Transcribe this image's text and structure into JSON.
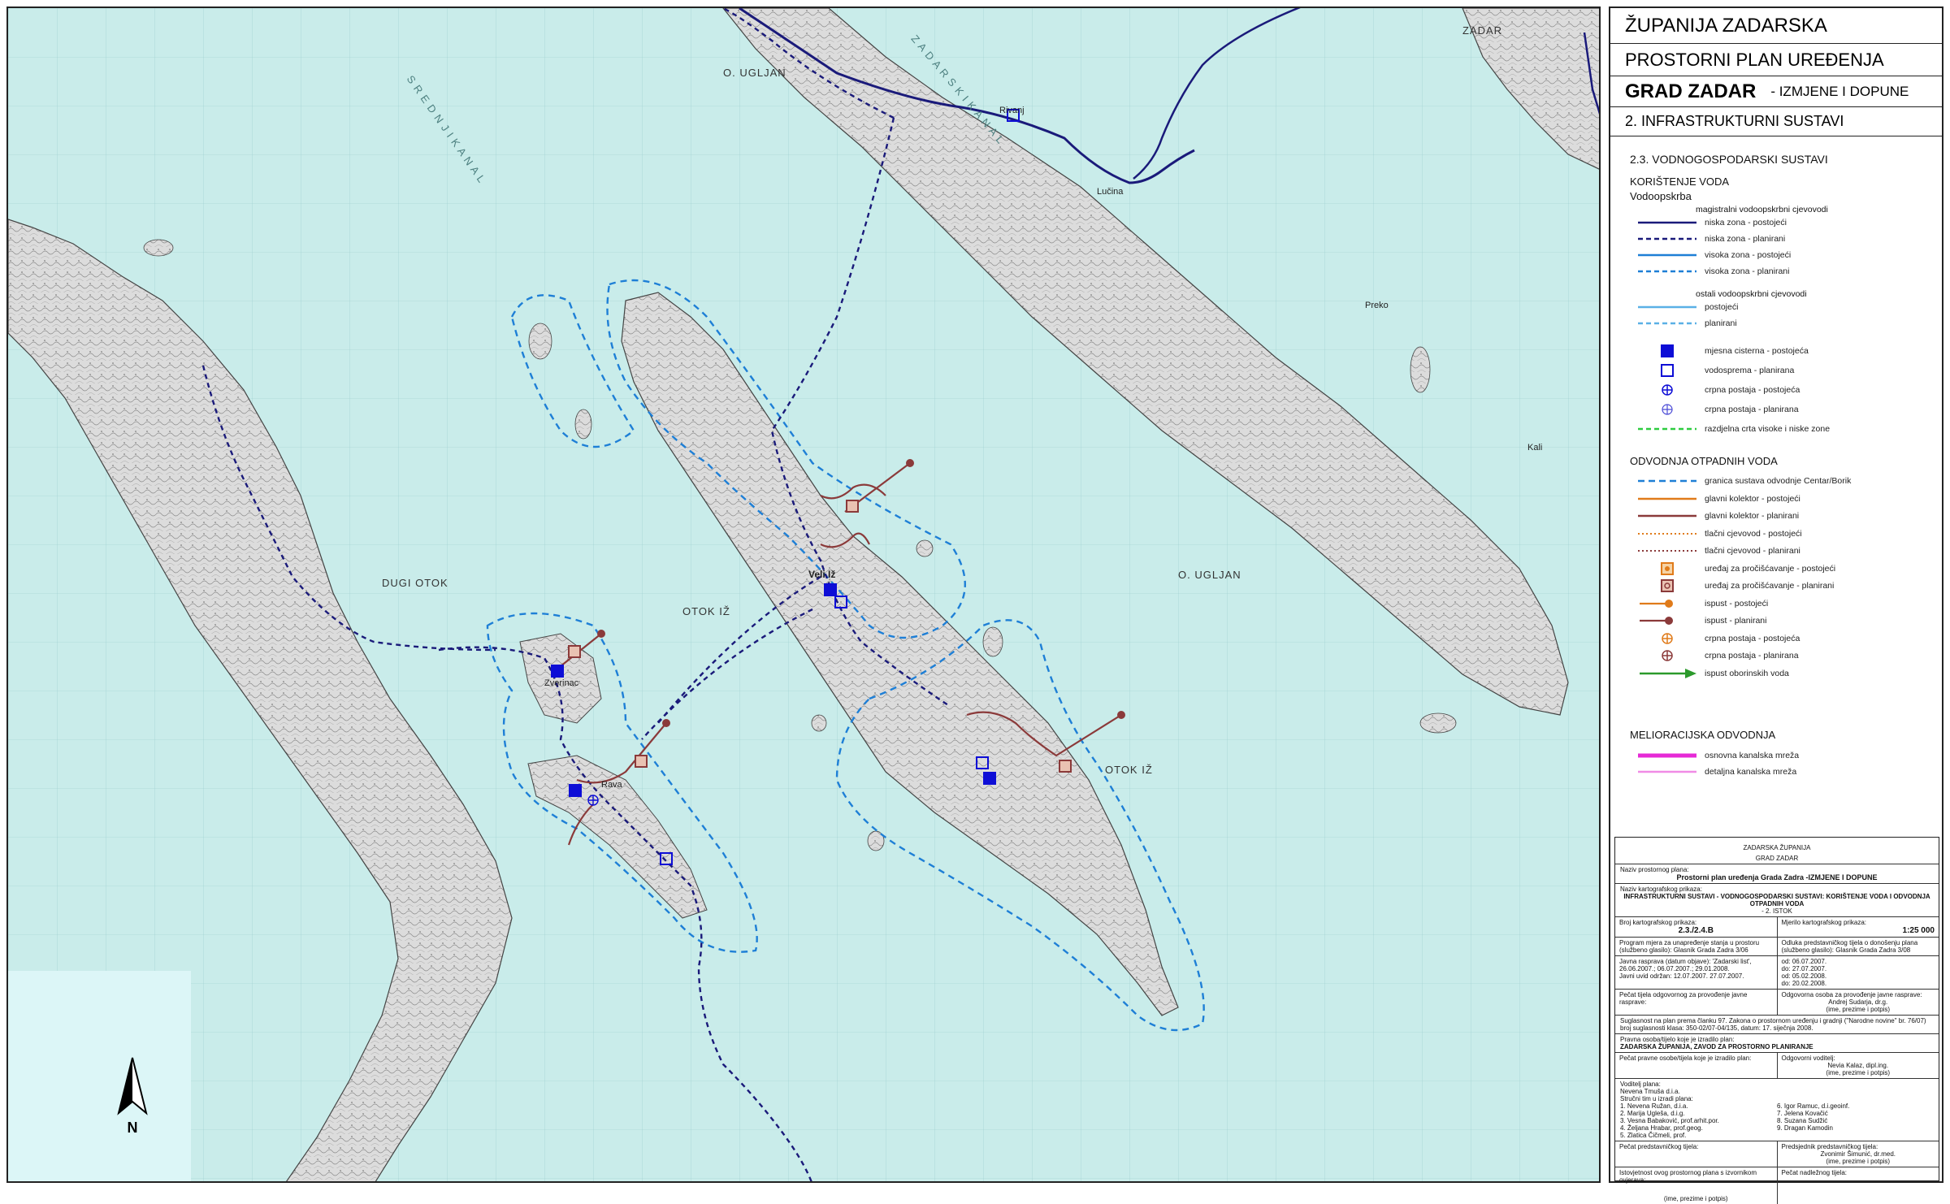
{
  "header": {
    "county": "ŽUPANIJA ZADARSKA",
    "plan": "PROSTORNI PLAN UREĐENJA",
    "city": "GRAD ZADAR",
    "city_suffix": "- IZMJENE I DOPUNE",
    "section": "2. INFRASTRUKTURNI SUSTAVI"
  },
  "legend": {
    "heading": "2.3. VODNOGOSPODARSKI SUSTAVI",
    "water_use": "KORIŠTENJE VODA",
    "supply": "Vodoopskrba",
    "main_pipe_title": "magistralni vodoopskrbni cjevovodi",
    "supply_items": [
      {
        "label": "niska zona - postojeći",
        "color": "#1a1a7a",
        "style": "solid"
      },
      {
        "label": "niska zona - planirani",
        "color": "#1a1a7a",
        "style": "dashed"
      },
      {
        "label": "visoka zona - postojeći",
        "color": "#1e7fd6",
        "style": "solid"
      },
      {
        "label": "visoka zona - planirani",
        "color": "#1e7fd6",
        "style": "dashed"
      }
    ],
    "other_pipe_title": "ostali vodoopskrbni cjevovodi",
    "other_items": [
      {
        "label": "postojeći",
        "color": "#5ab0e6",
        "style": "solid"
      },
      {
        "label": "planirani",
        "color": "#5ab0e6",
        "style": "dashed"
      }
    ],
    "symbol_items": [
      {
        "label": "mjesna cisterna - postojeća",
        "symbol": "square-filled"
      },
      {
        "label": "vodosprema - planirana",
        "symbol": "square-open"
      },
      {
        "label": "crpna postaja - postojeća",
        "symbol": "pump-existing"
      },
      {
        "label": "crpna postaja - planirana",
        "symbol": "pump-planned"
      },
      {
        "label": "razdjelna crta visoke i niske zone",
        "symbol": "green-dashed"
      }
    ],
    "waste_heading": "ODVODNJA OTPADNIH VODA",
    "waste_items": [
      {
        "label": "granica sustava odvodnje Centar/Borik",
        "symbol": "blue-dashed"
      },
      {
        "label": "glavni kolektor - postojeći",
        "symbol": "orange-solid"
      },
      {
        "label": "glavni kolektor - planirani",
        "symbol": "brown-solid"
      },
      {
        "label": "tlačni cjevovod - postojeći",
        "symbol": "orange-dotted"
      },
      {
        "label": "tlačni cjevovod - planirani",
        "symbol": "brown-dotted"
      },
      {
        "label": "uređaj za pročišćavanje - postojeći",
        "symbol": "plant-existing"
      },
      {
        "label": "uređaj za pročišćavanje - planirani",
        "symbol": "plant-planned"
      },
      {
        "label": "ispust - postojeći",
        "symbol": "outlet-existing"
      },
      {
        "label": "ispust - planirani",
        "symbol": "outlet-planned"
      },
      {
        "label": "crpna postaja - postojeća",
        "symbol": "pump-orange"
      },
      {
        "label": "crpna postaja - planirana",
        "symbol": "pump-brown"
      },
      {
        "label": "ispust oborinskih voda",
        "symbol": "green-arrow"
      }
    ],
    "melio_heading": "MELIORACIJSKA ODVODNJA",
    "melio_items": [
      {
        "label": "osnovna kanalska mreža",
        "symbol": "magenta-thick"
      },
      {
        "label": "detaljna kanalska mreža",
        "symbol": "pink-thin"
      }
    ]
  },
  "title_block": {
    "top1": "ZADARSKA ŽUPANIJA",
    "top2": "GRAD ZADAR",
    "plan_label": "Naziv prostornog plana:",
    "plan_name": "Prostorni plan uređenja Grada Zadra -IZMJENE I DOPUNE",
    "map_label": "Naziv kartografskog prikaza:",
    "map_name": "INFRASTRUKTURNI SUSTAVI - VODNOGOSPODARSKI SUSTAVI: KORIŠTENJE VODA I ODVODNJA OTPADNIH VODA",
    "map_sub": "- 2. ISTOK",
    "num_label": "Broj kartografskog prikaza:",
    "num": "2.3./2.4.B",
    "scale_label": "Mjerilo kartografskog prikaza:",
    "scale": "1:25 000",
    "program": "Program mjera za unapređenje stanja u prostoru (službeno glasilo): Glasnik Grada Zadra 3/06",
    "decision": "Odluka predstavničkog tijela o donošenju plana (službeno glasilo): Glasnik Grada Zadra 3/08",
    "debate": "Javna rasprava (datum objave): 'Zadarski list', 26.06.2007.; 06.07.2007.; 29.01.2008.",
    "insight": "Javni uvid održan: 12.07.2007. 27.07.2007.",
    "insight_from": "od: 06.07.2007.",
    "insight_to": "do: 27.07.2007.",
    "repeat_from": "od: 05.02.2008.",
    "repeat_to": "do: 20.02.2008.",
    "seal1": "Pečat tijela odgovornog za provođenje javne rasprave:",
    "resp": "Odgovorna osoba za provođenje javne rasprave:",
    "resp_name": "Andrej Sudarja, dr.g.",
    "sign": "(ime, prezime i potpis)",
    "consent": "Suglasnost na plan prema članku 97. Zakona o prostornom uređenju i gradnji (\"Narodne novine\" br. 76/07) broj suglasnosti klasa: 350-02/07-04/135, datum: 17. siječnja 2008.",
    "maker_label": "Pravna osoba/tijelo koje je izradilo plan:",
    "maker": "ZADARSKA ŽUPANIJA, ZAVOD ZA PROSTORNO PLANIRANJE",
    "seal2": "Pečat pravne osobe/tijela koje je izradilo plan:",
    "manager": "Odgovorni voditelj:",
    "manager_name": "Nevia Kalaz, dipl.ing.",
    "lead_label": "Voditelj plana:",
    "lead": "Nevena Tmuša d.i.a.",
    "team_label": "Stručni tim u izradi plana:",
    "team_left": [
      "1. Nevena Ružan, d.i.a.",
      "2. Marija Ugleša, d.i.g.",
      "3. Vesna Babaković, prof.arhit.por.",
      "4. Željana Hrabar, prof.geog.",
      "5. Zlatica Čičmeli, prof."
    ],
    "team_right": [
      "6. Igor Ramuc, d.i.geoinf.",
      "7. Jelena Kovačić",
      "8. Suzana Sudžić",
      "9. Dragan Kamodin"
    ],
    "seal3": "Pečat predstavničkog tijela:",
    "chairman": "Predsjednik predstavničkog tijela:",
    "chairman_name": "Zvonimir Šimunić, dr.med.",
    "certify": "Istovjetnost ovog prostornog plana s izvornikom ovjerava:",
    "seal4": "Pečat nadležnog tijela:"
  },
  "map": {
    "north": "N",
    "places": [
      "O. UGLJAN",
      "ZADAR",
      "DUGI OTOK",
      "OTOK IŽ",
      "O. UGLJAN",
      "OTOK IŽ",
      "Veli Iž",
      "Preko",
      "Kali",
      "Rava",
      "Lučina",
      "Zverinac",
      "Rivanj"
    ],
    "sea_labels": [
      "S R E D N J I   K A N A L",
      "Z A D A R S K I   K A N A L"
    ]
  }
}
